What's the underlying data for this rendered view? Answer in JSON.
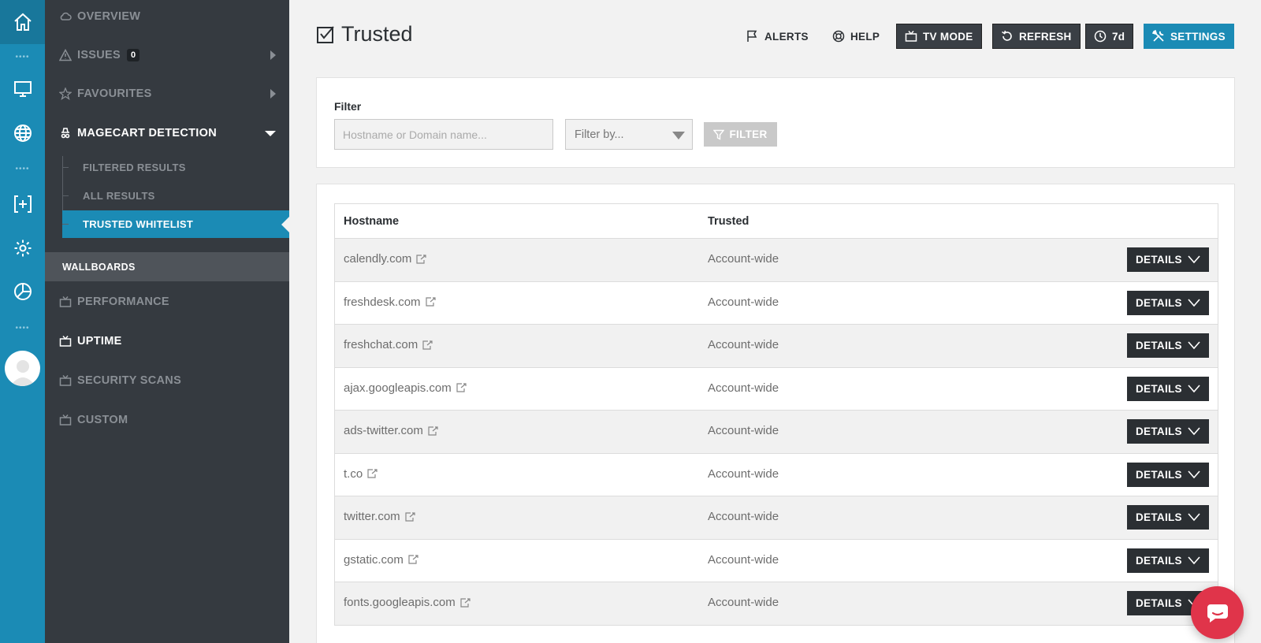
{
  "rail": {
    "icons": [
      "home-icon",
      "monitor-icon",
      "globe-icon",
      "add-bracket-icon",
      "gear-icon",
      "pie-chart-icon"
    ]
  },
  "sidebar": {
    "items": [
      {
        "label": "OVERVIEW",
        "icon": "cloud-icon"
      },
      {
        "label": "ISSUES",
        "icon": "warning-icon",
        "badge": "0"
      },
      {
        "label": "FAVOURITES",
        "icon": "star-icon"
      },
      {
        "label": "MAGECART DETECTION",
        "icon": "spy-icon"
      }
    ],
    "magecart_sub": [
      "FILTERED RESULTS",
      "ALL RESULTS",
      "TRUSTED WHITELIST"
    ],
    "wallboards_label": "WALLBOARDS",
    "wallboards": [
      {
        "label": "PERFORMANCE",
        "icon": "tv-icon"
      },
      {
        "label": "UPTIME",
        "icon": "tv-icon"
      },
      {
        "label": "SECURITY SCANS",
        "icon": "tv-icon"
      },
      {
        "label": "CUSTOM",
        "icon": "tv-icon"
      }
    ]
  },
  "header": {
    "title": "Trusted",
    "alerts": "ALERTS",
    "help": "HELP",
    "tv_mode": "TV MODE",
    "refresh": "REFRESH",
    "period": "7d",
    "settings": "SETTINGS",
    "accent": "#1b8bb5"
  },
  "filter": {
    "label": "Filter",
    "input_placeholder": "Hostname or Domain name...",
    "select_value": "Filter by...",
    "button": "FILTER"
  },
  "table": {
    "columns": [
      "Hostname",
      "Trusted"
    ],
    "details_label": "DETAILS",
    "rows": [
      {
        "hostname": "calendly.com",
        "trusted": "Account-wide"
      },
      {
        "hostname": "freshdesk.com",
        "trusted": "Account-wide"
      },
      {
        "hostname": "freshchat.com",
        "trusted": "Account-wide"
      },
      {
        "hostname": "ajax.googleapis.com",
        "trusted": "Account-wide"
      },
      {
        "hostname": "ads-twitter.com",
        "trusted": "Account-wide"
      },
      {
        "hostname": "t.co",
        "trusted": "Account-wide"
      },
      {
        "hostname": "twitter.com",
        "trusted": "Account-wide"
      },
      {
        "hostname": "gstatic.com",
        "trusted": "Account-wide"
      },
      {
        "hostname": "fonts.googleapis.com",
        "trusted": "Account-wide"
      }
    ]
  },
  "chat": {
    "icon": "chat-bubble-icon",
    "color": "#e0344a"
  }
}
